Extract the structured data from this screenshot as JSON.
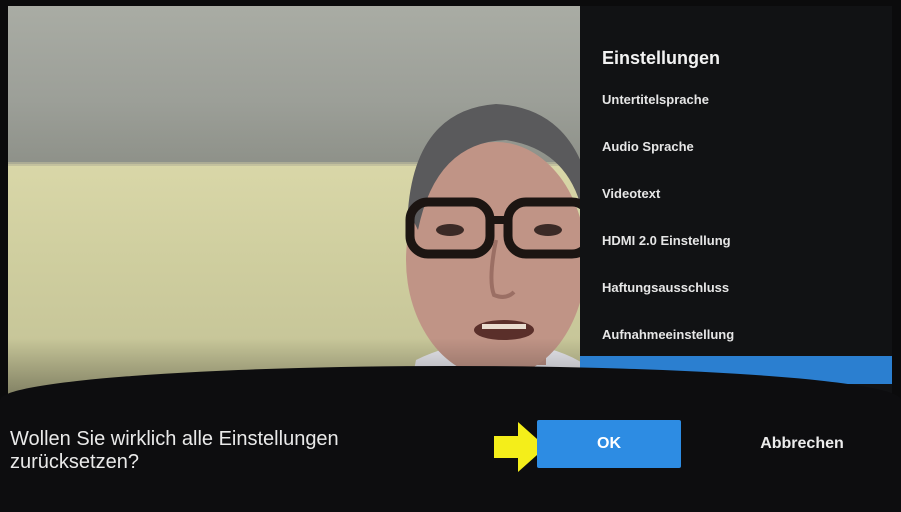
{
  "settings_panel": {
    "title": "Einstellungen",
    "items": [
      {
        "label": "Untertitelsprache"
      },
      {
        "label": "Audio Sprache"
      },
      {
        "label": "Videotext"
      },
      {
        "label": "HDMI 2.0 Einstellung"
      },
      {
        "label": "Haftungsausschluss"
      },
      {
        "label": "Aufnahmeeinstellung"
      }
    ]
  },
  "dialog": {
    "question_line1": "Wollen Sie wirklich alle Einstellungen",
    "question_line2": "zurücksetzen?",
    "ok_label": "OK",
    "cancel_label": "Abbrechen"
  },
  "colors": {
    "accent": "#2d8ce3",
    "arrow": "#f4ee1a",
    "panel_bg": "#111214"
  },
  "icons": {
    "pointer_arrow": "yellow-arrow-icon"
  }
}
